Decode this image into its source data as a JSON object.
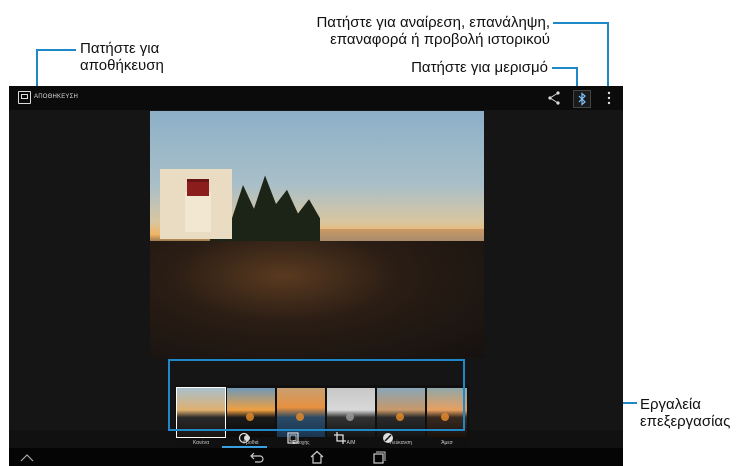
{
  "callouts": {
    "save": "Πατήστε για\nαποθήκευση",
    "undo_line1": "Πατήστε για αναίρεση, επανάληψη,",
    "undo_line2": "επαναφορά ή προβολή ιστορικού",
    "share": "Πατήστε για μερισμό",
    "tools_line1": "Εργαλεία",
    "tools_line2": "επεξεργασίας"
  },
  "action_bar": {
    "save_label": "ΑΠΟΘΗΚΕΥΣΗ",
    "icons": [
      "save-icon",
      "share-icon",
      "bluetooth-icon",
      "overflow-menu-icon"
    ]
  },
  "filters": [
    {
      "label": "Κανένα",
      "selected": true
    },
    {
      "label": "Γροθιά",
      "selected": false
    },
    {
      "label": "Εποχής",
      "selected": false
    },
    {
      "label": "Α/Μ",
      "selected": false
    },
    {
      "label": "Λεύκανση",
      "selected": false
    },
    {
      "label": "Άμεσ",
      "selected": false
    }
  ],
  "tools": [
    "filters-icon",
    "border-icon",
    "crop-icon",
    "adjust-icon"
  ],
  "nav": [
    "back-icon",
    "home-icon",
    "recent-apps-icon"
  ],
  "colors": {
    "accent": "#1e88c8",
    "screen_bg": "#111111"
  }
}
